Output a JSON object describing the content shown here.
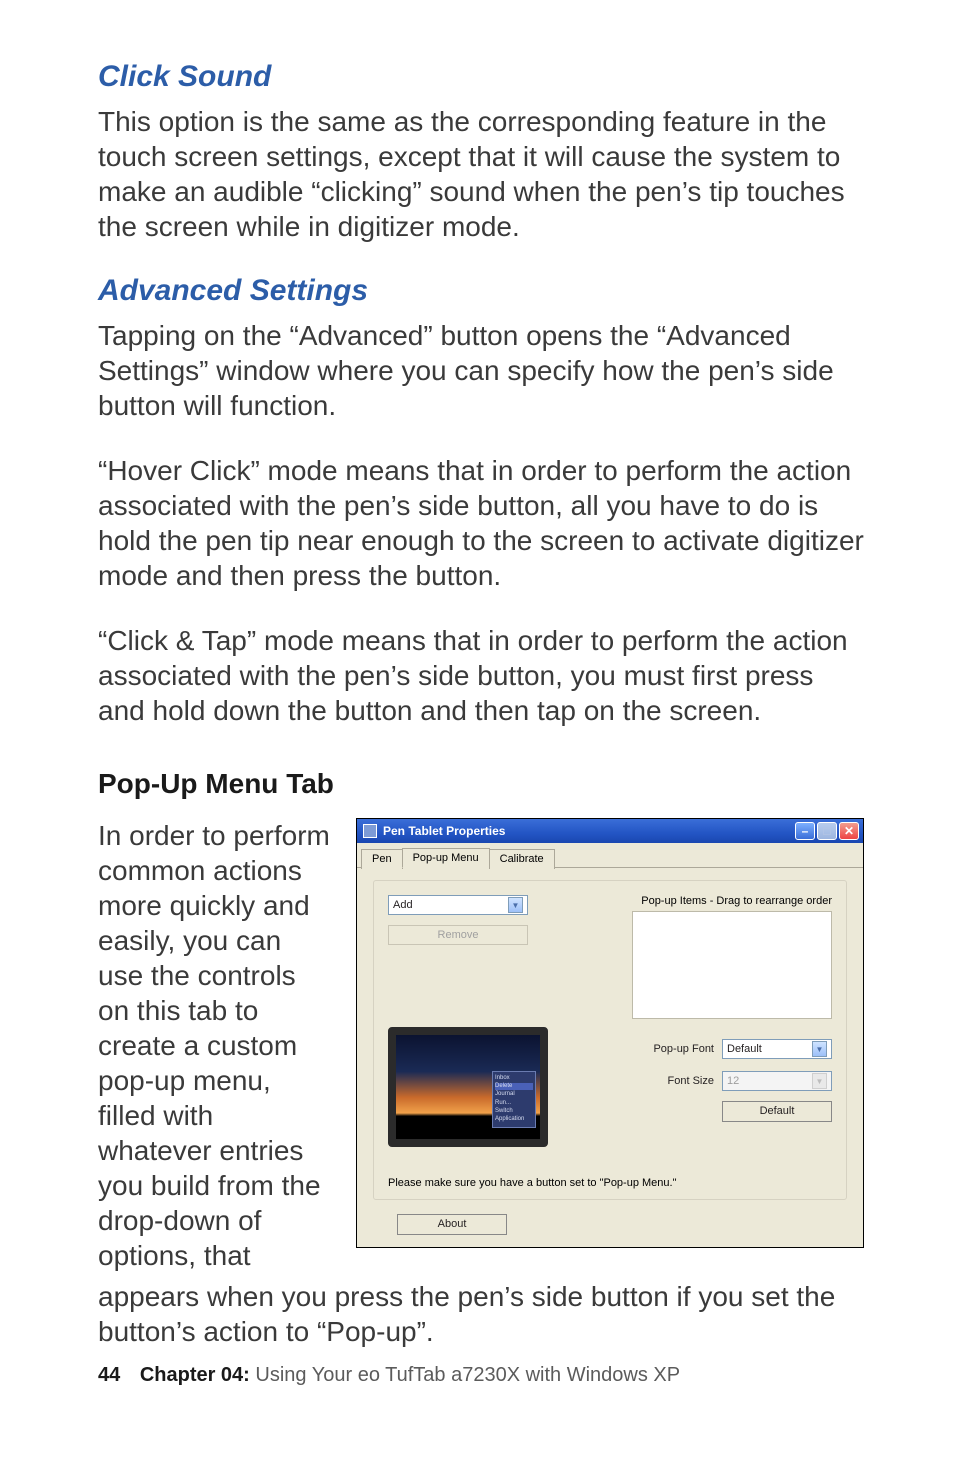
{
  "blueHeading1": "Click Sound",
  "para1": "This option is the same as the corresponding feature in the touch screen settings, except that it will cause the system to make an audible “clicking” sound when the pen’s tip touches the screen while in digitizer mode.",
  "blueHeading2": "Advanced Settings",
  "para2": "Tapping on the “Advanced” button opens the “Advanced Settings” window where you can specify how the pen’s side button will function.",
  "para3": "“Hover Click” mode means that in order to perform the action associated with the pen’s side button, all you have to do is hold the pen tip near enough to the screen to activate digitizer mode and then press the button.",
  "para4": "“Click & Tap” mode means that in order to perform the action associated with the pen’s side button, you must first press and hold down the button and then tap on the screen.",
  "popHeading": "Pop-Up Menu Tab",
  "leftPara": "In order to perform common actions more quickly and easily, you can use the controls on this tab to create a custom pop-up menu, filled with whatever entries you build from the drop-down of options, that",
  "belowPara": "appears when you press the pen’s side button if you set the button’s action to “Pop-up”.",
  "footer": {
    "page": "44",
    "chapter": "Chapter 04:",
    "title": " Using Your eo TufTab a7230X with Windows XP"
  },
  "dlg": {
    "title": "Pen Tablet Properties",
    "tabs": {
      "pen": "Pen",
      "popup": "Pop-up Menu",
      "calibrate": "Calibrate"
    },
    "addLabel": "Add",
    "dragLabel": "Pop-up Items - Drag to rearrange order",
    "removeLabel": "Remove",
    "popupFontLabel": "Pop-up Font",
    "popupFontValue": "Default",
    "fontSizeLabel": "Font Size",
    "fontSizeValue": "12",
    "defaultBtn": "Default",
    "note": "Please make sure you have a button set to \"Pop-up Menu.\"",
    "aboutBtn": "About",
    "thumbMenu": {
      "i1": "Inbox",
      "i2": "Delete",
      "i3": "Journal",
      "i4": "Run...",
      "i5": "Switch",
      "i6": "Application"
    }
  }
}
